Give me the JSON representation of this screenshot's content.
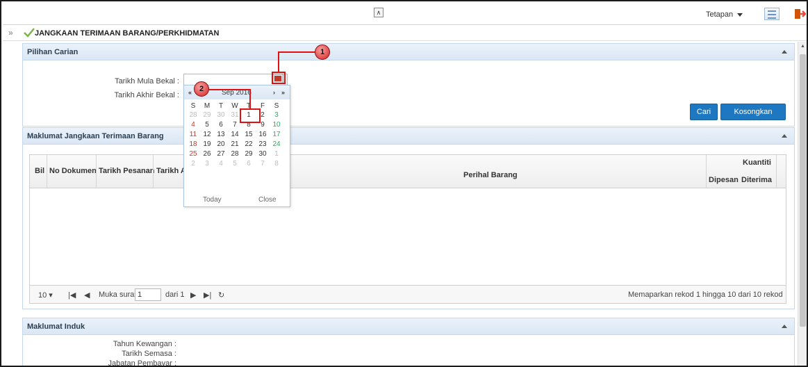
{
  "topbar": {
    "collapse_icon": "double-chevron-up",
    "settings_label": "Tetapan",
    "grid_icon": "grid-view-icon",
    "logout_icon": "logout-icon"
  },
  "title": {
    "text": "JANGKAAN TERIMAAN BARANG/PERKHIDMATAN",
    "check_color": "#7ab648"
  },
  "search_panel": {
    "title": "Pilihan Carian",
    "start_label": "Tarikh Mula Bekal :",
    "end_label": "Tarikh Akhir Bekal :",
    "search_button": "Cari",
    "clear_button": "Kosongkan"
  },
  "results_panel": {
    "title": "Maklumat Jangkaan Terimaan Barang",
    "columns": {
      "bil": "Bil",
      "no_dokumen": "No Dokumen",
      "tarikh_pesanan": "Tarikh Pesanan",
      "tarikh_partial": "Tarikh A",
      "perihal": "Perihal Barang",
      "kuantiti": "Kuantiti",
      "dipesan": "Dipesan",
      "diterima": "Diterima"
    },
    "pager": {
      "page_size": "10",
      "page_label": "Muka surat",
      "page_value": "1",
      "of_label": "dari 1",
      "summary": "Memaparkan rekod 1 hingga 10 dari 10 rekod"
    }
  },
  "induk_panel": {
    "title": "Maklumat Induk",
    "fields": [
      "Tahun Kewangan :",
      "Tarikh Semasa :",
      "Jabatan Pembayar :"
    ]
  },
  "datepicker": {
    "month": "Sep 2016",
    "prev_year": "«",
    "prev_month": "‹",
    "next_month": "›",
    "next_year": "»",
    "dow": [
      "S",
      "M",
      "T",
      "W",
      "T",
      "F",
      "S"
    ],
    "weeks": [
      [
        "28",
        "29",
        "30",
        "31",
        "1",
        "2",
        "3"
      ],
      [
        "4",
        "5",
        "6",
        "7",
        "8",
        "9",
        "10"
      ],
      [
        "11",
        "12",
        "13",
        "14",
        "15",
        "16",
        "17"
      ],
      [
        "18",
        "19",
        "20",
        "21",
        "22",
        "23",
        "24"
      ],
      [
        "25",
        "26",
        "27",
        "28",
        "29",
        "30",
        "1"
      ],
      [
        "2",
        "3",
        "4",
        "5",
        "6",
        "7",
        "8"
      ]
    ],
    "today": "Today",
    "close": "Close"
  },
  "callouts": {
    "one": "1",
    "two": "2"
  },
  "colors": {
    "accent": "#1d78c1",
    "callout": "#d62020",
    "highlight": "#e01010"
  }
}
